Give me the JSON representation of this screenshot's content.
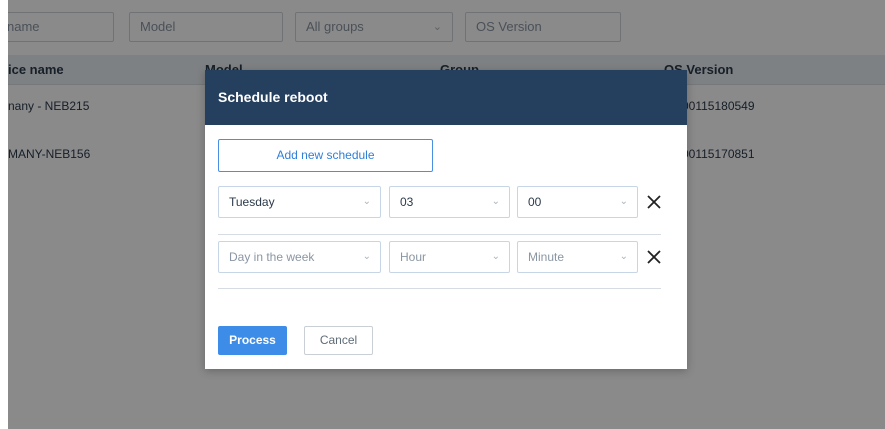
{
  "filters": {
    "device_name_placeholder": "name",
    "model_placeholder": "Model",
    "group_selected": "All groups",
    "os_version_placeholder": "OS Version"
  },
  "table": {
    "headers": [
      "ice name",
      "Model",
      "Group",
      "OS Version"
    ],
    "rows": [
      {
        "device": "nany - NEB215",
        "os": "00115180549"
      },
      {
        "device": "MANY-NEB156",
        "os": "00115170851"
      }
    ]
  },
  "modal": {
    "title": "Schedule reboot",
    "add_label": "Add new schedule",
    "schedules": [
      {
        "day": "Tuesday",
        "hour": "03",
        "minute": "00"
      },
      {
        "day": "Day in the week",
        "hour": "Hour",
        "minute": "Minute"
      }
    ],
    "process_label": "Process",
    "cancel_label": "Cancel"
  },
  "icons": {
    "chevron": "chevron-down-icon",
    "close": "close-icon"
  },
  "colors": {
    "header_bg": "#253f5f",
    "primary": "#3d8ce8",
    "overlay": "rgba(0,0,0,0.46)"
  }
}
